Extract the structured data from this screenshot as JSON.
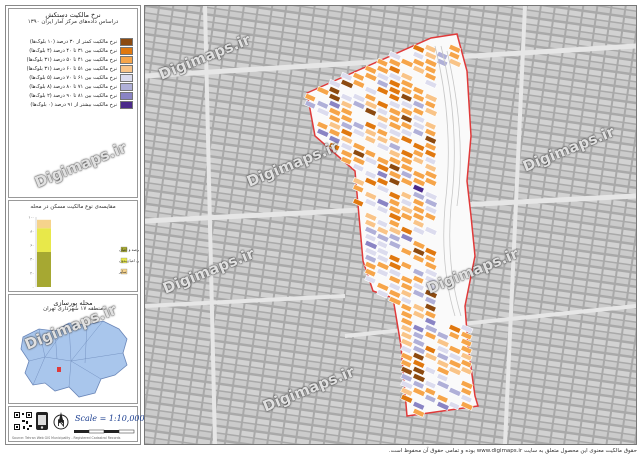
{
  "legend": {
    "title": "نرخ مالکیت دستکش",
    "subtitle": "دراساس داده‌های مرکز آمار ایران ۱۳۹۰",
    "items": [
      {
        "label": "نرخ مالکیت کمتر از ۳۰ درصد (۱۰ بلوک‌ها)",
        "color": "#8c4a10"
      },
      {
        "label": "نرخ مالکیت بین ۳۱ تا ۴۰ درصد (۴ بلوک‌ها)",
        "color": "#e0780f"
      },
      {
        "label": "نرخ مالکیت بین ۴۱ تا ۵۰ درصد (۳۱ بلوک‌ها)",
        "color": "#f6a54a"
      },
      {
        "label": "نرخ مالکیت بین ۵۱ تا ۶۰ درصد (۳۱ بلوک‌ها)",
        "color": "#f9c488"
      },
      {
        "label": "نرخ مالکیت بین ۶۱ تا ۷۰ درصد (۵ بلوک‌ها)",
        "color": "#dcdcee"
      },
      {
        "label": "نرخ مالکیت بین ۷۱ تا ۸۰ درصد (۸ بلوک‌ها)",
        "color": "#b0b0d8"
      },
      {
        "label": "نرخ مالکیت بین ۸۱ تا ۹۰ درصد (۲ بلوک‌ها)",
        "color": "#8a84c4"
      },
      {
        "label": "نرخ مالکیت بیشتر از ۹۱ درصد (۰ بلوک‌ها)",
        "color": "#4b2a8a"
      }
    ]
  },
  "chart": {
    "title": "مقایسه‌ی نوع مالکیت مسکن در محله",
    "ticks": [
      "۱۰۰",
      "۸۰",
      "۶۰",
      "۴۰",
      "۲۰",
      "۰"
    ],
    "legend": [
      {
        "label": "ملکی عرصه و اعیان",
        "color": "#a6a832"
      },
      {
        "label": "ملکی اعیان‌بدون",
        "color": "#e8e84a"
      },
      {
        "label": "سایر",
        "color": "#f6d38c"
      }
    ]
  },
  "chart_data": {
    "type": "bar",
    "categories": [
      ""
    ],
    "series": [
      {
        "name": "ملکی عرصه و اعیان",
        "values": [
          50
        ]
      },
      {
        "name": "ملکی اعیان‌بدون",
        "values": [
          34
        ]
      },
      {
        "name": "سایر",
        "values": [
          12
        ]
      }
    ],
    "ylim": [
      0,
      100
    ],
    "title": "مقایسه‌ی نوع مالکیت مسکن در محله"
  },
  "location": {
    "title": "محله پورسازی",
    "subtitle": "منطقه ۱۷ شهرداری تهران"
  },
  "scale": {
    "text": "Scale = 1:10,000",
    "source": "Source: Tehran Web GIS Municipality - Registered Cadastral Records"
  },
  "watermark": "Digimaps.ir",
  "footer": "حقوق مالکیت معنوی این محصول متعلق به سایت www.digimaps.ir بوده و تمامی حقوق آن محفوظ است.",
  "colors": {
    "street_bg": "#c9c9c9",
    "district": "#fafafa",
    "boundary": "#e03a3a"
  }
}
